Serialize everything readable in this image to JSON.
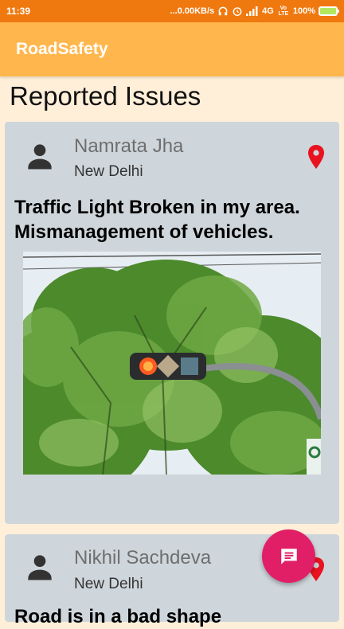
{
  "status_bar": {
    "time": "11:39",
    "network_speed": "...0.00KB/s",
    "network_type": "4G",
    "volte": "Vo LTE",
    "battery": "100%"
  },
  "app_bar": {
    "title": "RoadSafety"
  },
  "page": {
    "title": "Reported Issues"
  },
  "issues": [
    {
      "author": "Namrata Jha",
      "location": "New Delhi",
      "text": "Traffic Light Broken in my area. Mismanagement of vehicles.",
      "photo_icon": "traffic-light-photo"
    },
    {
      "author": "Nikhil Sachdeva",
      "location": "New Delhi",
      "text": "Road is in a bad shape"
    }
  ],
  "fab": {
    "icon": "message-icon"
  },
  "colors": {
    "status_bar": "#f0790f",
    "app_bar": "#ffb74d",
    "background": "#ffefd9",
    "card": "#cfd6db",
    "pin": "#e8131f",
    "fab": "#e01f66"
  }
}
